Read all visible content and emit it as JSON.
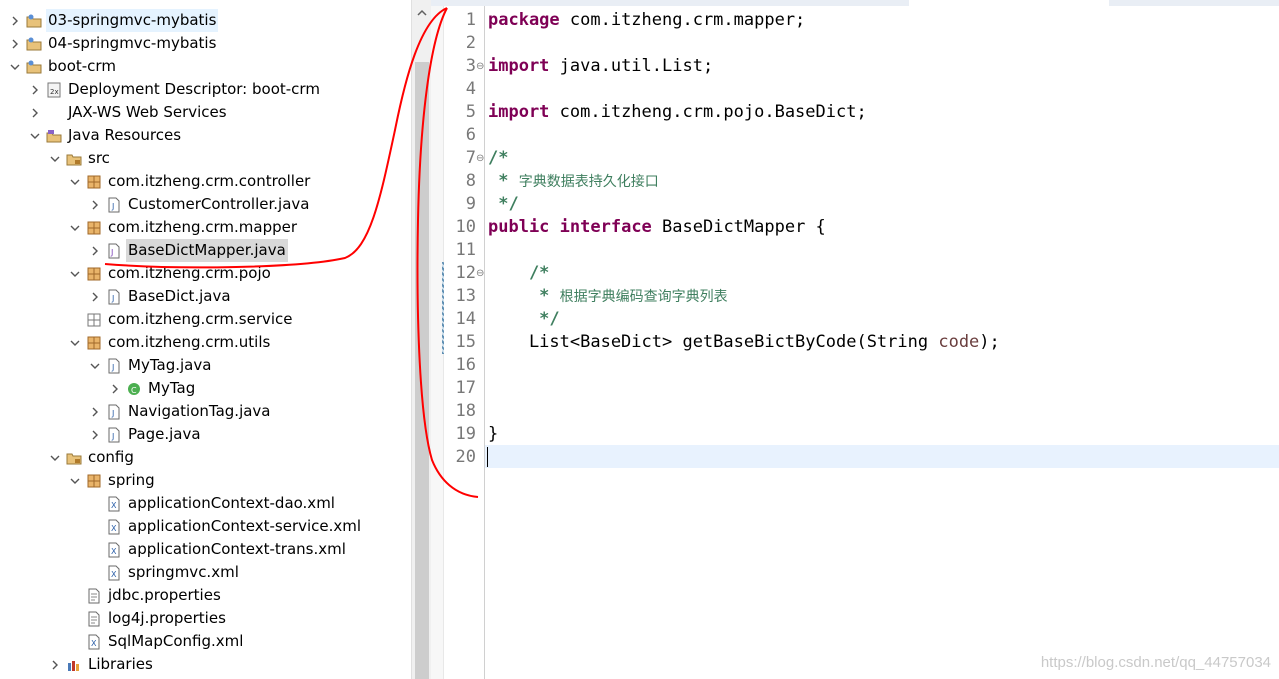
{
  "explorer": {
    "items": [
      {
        "label": "03-springmvc-mybatis",
        "icon": "project-icon",
        "arrow": "right"
      },
      {
        "label": "04-springmvc-mybatis",
        "icon": "project-icon",
        "arrow": "right"
      },
      {
        "label": "boot-crm",
        "icon": "project-icon",
        "arrow": "down"
      },
      {
        "label": "Deployment Descriptor: boot-crm",
        "icon": "deployment-descriptor-icon",
        "arrow": "right"
      },
      {
        "label": "JAX-WS Web Services",
        "icon": "web-services-icon",
        "arrow": "right"
      },
      {
        "label": "Java Resources",
        "icon": "java-resources-icon",
        "arrow": "down"
      },
      {
        "label": "src",
        "icon": "source-folder-icon",
        "arrow": "down"
      },
      {
        "label": "com.itzheng.crm.controller",
        "icon": "package-icon",
        "arrow": "down"
      },
      {
        "label": "CustomerController.java",
        "icon": "java-file-icon",
        "arrow": "right"
      },
      {
        "label": "com.itzheng.crm.mapper",
        "icon": "package-icon",
        "arrow": "down"
      },
      {
        "label": "BaseDictMapper.java",
        "icon": "java-interface-file-icon",
        "arrow": "right"
      },
      {
        "label": "com.itzheng.crm.pojo",
        "icon": "package-icon",
        "arrow": "down"
      },
      {
        "label": "BaseDict.java",
        "icon": "java-file-icon",
        "arrow": "right"
      },
      {
        "label": "com.itzheng.crm.service",
        "icon": "empty-package-icon",
        "arrow": "none"
      },
      {
        "label": "com.itzheng.crm.utils",
        "icon": "package-icon",
        "arrow": "down"
      },
      {
        "label": "MyTag.java",
        "icon": "java-file-icon",
        "arrow": "down"
      },
      {
        "label": "MyTag",
        "icon": "class-icon",
        "arrow": "right"
      },
      {
        "label": "NavigationTag.java",
        "icon": "java-file-icon",
        "arrow": "right"
      },
      {
        "label": "Page.java",
        "icon": "java-file-icon",
        "arrow": "right"
      },
      {
        "label": "config",
        "icon": "source-folder-icon",
        "arrow": "down"
      },
      {
        "label": "spring",
        "icon": "package-icon",
        "arrow": "down"
      },
      {
        "label": "applicationContext-dao.xml",
        "icon": "xml-file-icon",
        "arrow": "none"
      },
      {
        "label": "applicationContext-service.xml",
        "icon": "xml-file-icon",
        "arrow": "none"
      },
      {
        "label": "applicationContext-trans.xml",
        "icon": "xml-file-icon",
        "arrow": "none"
      },
      {
        "label": "springmvc.xml",
        "icon": "xml-file-icon",
        "arrow": "none"
      },
      {
        "label": "jdbc.properties",
        "icon": "properties-file-icon",
        "arrow": "none"
      },
      {
        "label": "log4j.properties",
        "icon": "properties-file-icon",
        "arrow": "none"
      },
      {
        "label": "SqlMapConfig.xml",
        "icon": "xml-file-icon",
        "arrow": "none"
      },
      {
        "label": "Libraries",
        "icon": "libraries-icon",
        "arrow": "right"
      }
    ]
  },
  "editor": {
    "line_numbers": [
      "1",
      "2",
      "3",
      "4",
      "5",
      "6",
      "7",
      "8",
      "9",
      "10",
      "11",
      "12",
      "13",
      "14",
      "15",
      "16",
      "17",
      "18",
      "19",
      "20"
    ],
    "lines": [
      {
        "parts": [
          [
            "kw",
            "package"
          ],
          [
            "",
            " com.itzheng.crm.mapper;"
          ]
        ]
      },
      {
        "parts": []
      },
      {
        "parts": [
          [
            "kw",
            "import"
          ],
          [
            "",
            " java.util.List;"
          ]
        ]
      },
      {
        "parts": []
      },
      {
        "parts": [
          [
            "kw",
            "import"
          ],
          [
            "",
            " com.itzheng.crm.pojo.BaseDict;"
          ]
        ]
      },
      {
        "parts": []
      },
      {
        "parts": [
          [
            "cm",
            "/*"
          ]
        ]
      },
      {
        "parts": [
          [
            "cm",
            " * "
          ],
          [
            "cmz",
            "字典数据表持久化接口"
          ]
        ]
      },
      {
        "parts": [
          [
            "cm",
            " */"
          ]
        ]
      },
      {
        "parts": [
          [
            "kw",
            "public"
          ],
          [
            "",
            " "
          ],
          [
            "kw",
            "interface"
          ],
          [
            "",
            " BaseDictMapper {"
          ]
        ]
      },
      {
        "parts": []
      },
      {
        "parts": [
          [
            "cm",
            "    /*"
          ]
        ]
      },
      {
        "parts": [
          [
            "cm",
            "     * "
          ],
          [
            "cmz",
            "根据字典编码查询字典列表"
          ]
        ]
      },
      {
        "parts": [
          [
            "cm",
            "     */"
          ]
        ]
      },
      {
        "parts": [
          [
            "",
            "    List<BaseDict> getBaseBictByCode(String "
          ],
          [
            "pn",
            "code"
          ],
          [
            "",
            ");"
          ]
        ]
      },
      {
        "parts": []
      },
      {
        "parts": []
      },
      {
        "parts": []
      },
      {
        "parts": [
          [
            "",
            "}"
          ]
        ]
      },
      {
        "parts": []
      }
    ],
    "fold_markers": [
      "3",
      "7",
      "12"
    ]
  },
  "colors": {
    "keyword": "#7f0055",
    "comment": "#3f7f5f",
    "parameter": "#6a3e3e",
    "line_number": "#787878",
    "current_line": "#e8f2fe",
    "selection": "#d9d9d9",
    "annotation": "#ff0000"
  },
  "watermark": "https://blog.csdn.net/qq_44757034"
}
